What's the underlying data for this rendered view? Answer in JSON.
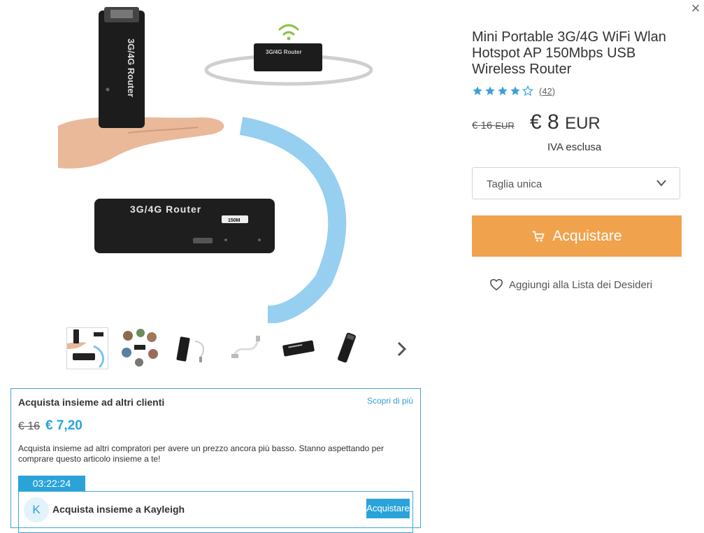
{
  "modal": {
    "close_icon": "close-icon"
  },
  "product": {
    "title": "Mini Portable 3G/4G WiFi Wlan Hotspot AP 150Mbps USB Wireless Router",
    "image_texts": {
      "device_label": "3G/4G Router",
      "badge": "150M"
    },
    "rating": {
      "value": 4,
      "max": 5,
      "count_label": "(42)"
    },
    "price": {
      "old_value": "€ 16",
      "old_currency": "EUR",
      "new_value": "€ 8",
      "new_currency": "EUR",
      "vat_note": "IVA esclusa"
    },
    "size_select": {
      "selected": "Taglia unica"
    },
    "buy_label": "Acquistare",
    "wishlist_label": "Aggiungi alla Lista dei Desideri"
  },
  "thumbnails": [
    {
      "name": "thumb-1",
      "active": true
    },
    {
      "name": "thumb-2",
      "active": false
    },
    {
      "name": "thumb-3",
      "active": false
    },
    {
      "name": "thumb-4",
      "active": false
    },
    {
      "name": "thumb-5",
      "active": false
    },
    {
      "name": "thumb-6",
      "active": false
    }
  ],
  "group_buy": {
    "title": "Acquista insieme ad altri clienti",
    "more_link": "Scopri di più",
    "old_price": "€ 16",
    "new_price": "€ 7,20",
    "description": "Acquista insieme ad altri compratori per avere un prezzo ancora più basso. Stanno aspettando per comprare questo articolo insieme a te!",
    "timer": "03:22:24",
    "invite": {
      "avatar_letter": "K",
      "text": "Acquista insieme a Kayleigh",
      "button": "Acquistare"
    }
  },
  "colors": {
    "accent_orange": "#f0a24c",
    "accent_blue": "#2aa3d9",
    "star_blue": "#3aa0d8"
  }
}
